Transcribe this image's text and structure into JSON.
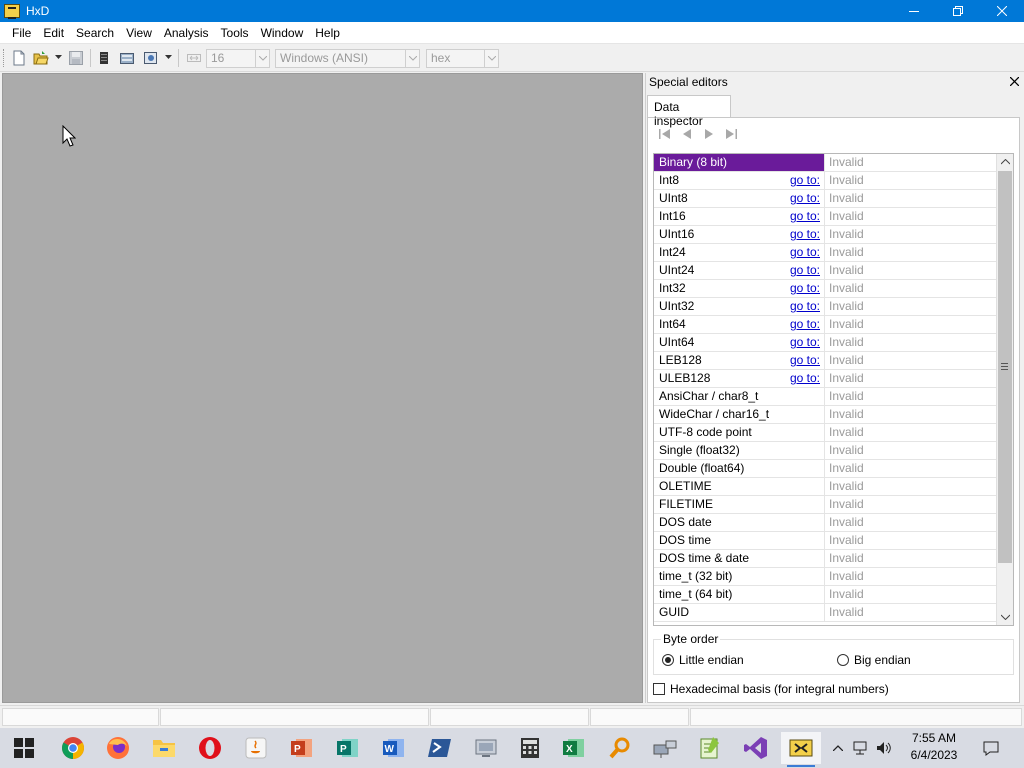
{
  "window": {
    "title": "HxD",
    "controls": [
      "minimize-icon",
      "restore-icon",
      "close-icon"
    ]
  },
  "menu": [
    "File",
    "Edit",
    "Search",
    "View",
    "Analysis",
    "Tools",
    "Window",
    "Help"
  ],
  "toolbar": {
    "bytes_per_row": "16",
    "charset": "Windows (ANSI)",
    "offset_base": "hex"
  },
  "panel": {
    "title": "Special editors",
    "tab": "Data inspector",
    "goto_label": "go to:",
    "rows": [
      {
        "name": "Binary (8 bit)",
        "value": "Invalid",
        "goto": false,
        "selected": true
      },
      {
        "name": "Int8",
        "value": "Invalid",
        "goto": true
      },
      {
        "name": "UInt8",
        "value": "Invalid",
        "goto": true
      },
      {
        "name": "Int16",
        "value": "Invalid",
        "goto": true
      },
      {
        "name": "UInt16",
        "value": "Invalid",
        "goto": true
      },
      {
        "name": "Int24",
        "value": "Invalid",
        "goto": true
      },
      {
        "name": "UInt24",
        "value": "Invalid",
        "goto": true
      },
      {
        "name": "Int32",
        "value": "Invalid",
        "goto": true
      },
      {
        "name": "UInt32",
        "value": "Invalid",
        "goto": true
      },
      {
        "name": "Int64",
        "value": "Invalid",
        "goto": true
      },
      {
        "name": "UInt64",
        "value": "Invalid",
        "goto": true
      },
      {
        "name": "LEB128",
        "value": "Invalid",
        "goto": true
      },
      {
        "name": "ULEB128",
        "value": "Invalid",
        "goto": true
      },
      {
        "name": "AnsiChar / char8_t",
        "value": "Invalid",
        "goto": false
      },
      {
        "name": "WideChar / char16_t",
        "value": "Invalid",
        "goto": false
      },
      {
        "name": "UTF-8 code point",
        "value": "Invalid",
        "goto": false
      },
      {
        "name": "Single (float32)",
        "value": "Invalid",
        "goto": false
      },
      {
        "name": "Double (float64)",
        "value": "Invalid",
        "goto": false
      },
      {
        "name": "OLETIME",
        "value": "Invalid",
        "goto": false
      },
      {
        "name": "FILETIME",
        "value": "Invalid",
        "goto": false
      },
      {
        "name": "DOS date",
        "value": "Invalid",
        "goto": false
      },
      {
        "name": "DOS time",
        "value": "Invalid",
        "goto": false
      },
      {
        "name": "DOS time & date",
        "value": "Invalid",
        "goto": false
      },
      {
        "name": "time_t (32 bit)",
        "value": "Invalid",
        "goto": false
      },
      {
        "name": "time_t (64 bit)",
        "value": "Invalid",
        "goto": false
      },
      {
        "name": "GUID",
        "value": "Invalid",
        "goto": false
      }
    ],
    "byte_order": {
      "label": "Byte order",
      "little": "Little endian",
      "big": "Big endian",
      "selected": "little"
    },
    "hex_basis": {
      "label": "Hexadecimal basis (for integral numbers)",
      "checked": false
    }
  },
  "taskbar": {
    "apps": [
      "windows-start",
      "chrome",
      "firefox",
      "file-explorer",
      "opera",
      "java",
      "powerpoint",
      "publisher",
      "word",
      "powershell",
      "vm-tool",
      "calculator",
      "excel",
      "search-tool",
      "network-tool",
      "notepad-plus",
      "visual-studio",
      "hxd"
    ],
    "time": "7:55 AM",
    "date": "6/4/2023"
  },
  "colors": {
    "titlebar": "#0078d7",
    "selected_row": "#6a1b9a",
    "workspace": "#ababab",
    "link": "#0000cc"
  }
}
